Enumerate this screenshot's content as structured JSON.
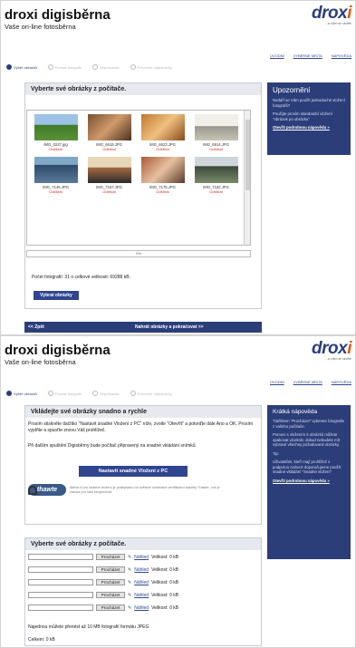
{
  "brand": {
    "title": "droxi digisběrna",
    "subtitle": "Vaše on-line fotosběrna"
  },
  "logo": {
    "name": "droxi",
    "tagline": "...a cítím se skvěle"
  },
  "top_links": [
    "ÚVODNÍ",
    "VYBĚRNÉ MÍSTA",
    "NÁPOVĚDA"
  ],
  "steps": [
    "Výběr obrázků",
    "Formát fotografií",
    "Objednávka",
    "Potvrzení objednávky"
  ],
  "screen1": {
    "panel_title": "Vyberte své obrázky z počítače.",
    "thumbnails": [
      {
        "name": "IMG_0237.jpg",
        "action": "Odebrat"
      },
      {
        "name": "IMG_6619.JPG",
        "action": "Odebrat"
      },
      {
        "name": "IMG_6623.JPG",
        "action": "Odebrat"
      },
      {
        "name": "IMG_6914.JPG",
        "action": "Odebrat"
      },
      {
        "name": "IMG_7145.JPG",
        "action": "Odebrat"
      },
      {
        "name": "IMG_7157.JPG",
        "action": "Odebrat"
      },
      {
        "name": "IMG_7175.JPG",
        "action": "Odebrat"
      },
      {
        "name": "IMG_7182.JPG",
        "action": "Odebrat"
      }
    ],
    "progress_label": "0%",
    "progress": 0,
    "count_text": "Počet fotografií: 31 o celkové velikosti: 69288 kB.",
    "choose_button": "Vybrat obrázky",
    "back_button": "<< Zpět",
    "next_button": "Nahrát obrázky a pokračovat >>",
    "sidebar": {
      "title": "Upozornění",
      "p1": "Nedaří se Vám použít jednoduché vložení fotografií?",
      "p2": "Použijte prosím standardní vložení \"obrázek po obrázku\"",
      "link": "Otevřít podrobnou nápovědu »"
    }
  },
  "screen2": {
    "panel1_title": "Vkládejte své obrázky snadno a rychle",
    "p1": "Prosím stiskněte tlačítko \"Nastavit snadné Vložení z PC\" níže, zvolte \"Otevřít\" a potvrďte dále Ano a OK. Prosím vyplňte a spusťte znovu Váš prohlížeč.",
    "p2": "Při dalším spuštění Digisběrny bude počítač připravený na snadné vkládání snímků.",
    "setup_button": "Nastavit snadné Vložení z PC",
    "thawte_brand": "thawte",
    "thawte_text": "Aktiva # pro snadné vložení je podepsáno od světově uznávané certifikační autority Thawte, což je záruka pro vaši bezpečnost.",
    "panel2_title": "Vyberte své obrázky z počítače.",
    "file_rows": [
      {
        "browse": "Procházet",
        "preview": "Náhled",
        "size": "Velikost: 0 kB"
      },
      {
        "browse": "Procházet",
        "preview": "Náhled",
        "size": "Velikost: 0 kB"
      },
      {
        "browse": "Procházet",
        "preview": "Náhled",
        "size": "Velikost: 0 kB"
      },
      {
        "browse": "Procházet",
        "preview": "Náhled",
        "size": "Velikost: 0 kB"
      },
      {
        "browse": "Procházet",
        "preview": "Náhled",
        "size": "Velikost: 0 kB"
      }
    ],
    "limit_text": "Najednou můžete přenést až 10 MB fotografií formátu JPEG",
    "total_text": "Celkem: 0 kB",
    "sidebar": {
      "title": "Krátká nápověda",
      "p1": "Tlačítkem \"Procházet\" vyberete fotografie z vašeho počítače.",
      "p2": "Pomoci s vložením 5 obrázků můžete opakovat vícekrát, dokud nebudete mít vybrané všechny požadované obrázky.",
      "p3": "Tip:",
      "p4": "Uživatelům, kteří mají prohlížeč s podporou ActiveX doporučujeme použít snadné vkládání \"Snadné vložení\"",
      "link": "Otevřít podrobnou nápovědu »"
    }
  },
  "colors": {
    "navy": "#2b3e7a",
    "accent": "#e05a10",
    "delete": "#dd2222"
  }
}
